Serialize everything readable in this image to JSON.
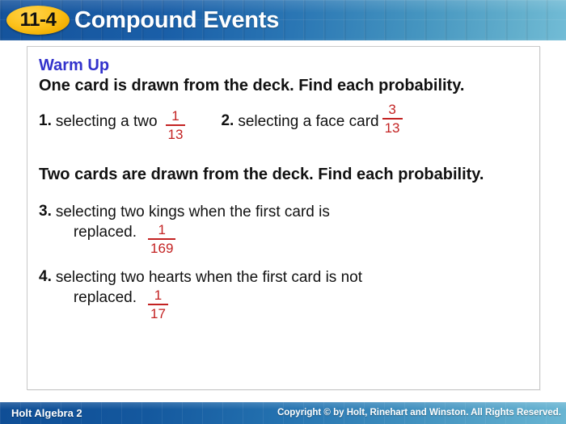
{
  "header": {
    "lesson_number": "11-4",
    "title": "Compound Events",
    "bg_left_color": "#1a5fa8",
    "bg_right_color": "#6ab6d3",
    "badge_color": "#fdc21c"
  },
  "slide": {
    "warmup_label": "Warm Up",
    "warmup_color": "#3333cc",
    "answer_color": "#c32222",
    "prompt_1": "One card is drawn from the deck. Find each probability.",
    "prompt_2": "Two cards are drawn from the deck. Find each probability.",
    "questions": [
      {
        "number": "1.",
        "text": "selecting a two",
        "answer_numerator": "1",
        "answer_denominator": "13"
      },
      {
        "number": "2.",
        "text": "selecting a face card",
        "answer_numerator": "3",
        "answer_denominator": "13"
      },
      {
        "number": "3.",
        "text_line1": "selecting two kings when the first card is",
        "text_line2": "replaced.",
        "answer_numerator": "1",
        "answer_denominator": "169"
      },
      {
        "number": "4.",
        "text_line1": "selecting two hearts when the first card is not",
        "text_line2": "replaced.",
        "answer_numerator": "1",
        "answer_denominator": "17"
      }
    ]
  },
  "footer": {
    "book_title": "Holt Algebra 2",
    "copyright": "Copyright © by Holt, Rinehart and Winston. All Rights Reserved."
  }
}
